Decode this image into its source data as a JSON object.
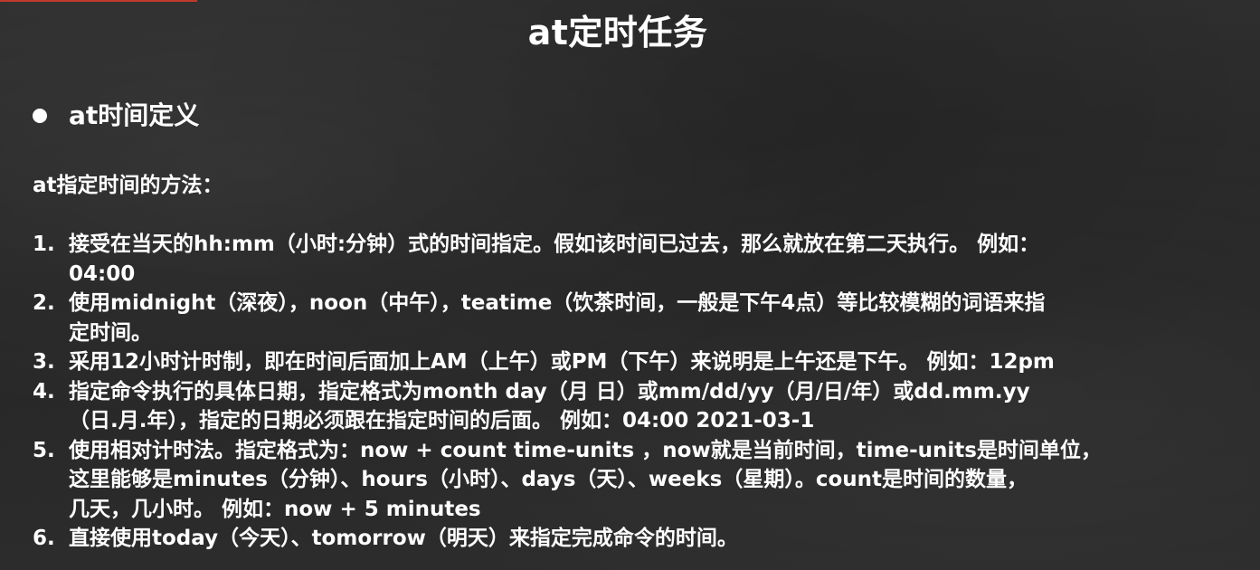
{
  "slide": {
    "title": "at定时任务",
    "section_label": "at时间定义",
    "intro": "at指定时间的方法：",
    "items": [
      {
        "num": "1.",
        "text": "接受在当天的hh:mm（小时:分钟）式的时间指定。假如该时间已过去，那么就放在第二天执行。 例如：\n04:00"
      },
      {
        "num": "2.",
        "text": "使用midnight（深夜），noon（中午），teatime（饮茶时间，一般是下午4点）等比较模糊的词语来指\n定时间。"
      },
      {
        "num": "3.",
        "text": "采用12小时计时制，即在时间后面加上AM（上午）或PM（下午）来说明是上午还是下午。 例如：12pm"
      },
      {
        "num": "4.",
        "text": "指定命令执行的具体日期，指定格式为month day（月 日）或mm/dd/yy（月/日/年）或dd.mm.yy\n（日.月.年），指定的日期必须跟在指定时间的后面。 例如：04:00 2021-03-1"
      },
      {
        "num": "5.",
        "text": "使用相对计时法。指定格式为：now + count time-units ，now就是当前时间，time-units是时间单位，\n这里能够是minutes（分钟）、hours（小时）、days（天）、weeks（星期）。count是时间的数量，\n几天，几小时。 例如：now + 5 minutes"
      },
      {
        "num": "6.",
        "text": "直接使用today（今天）、tomorrow（明天）来指定完成命令的时间。"
      }
    ]
  }
}
